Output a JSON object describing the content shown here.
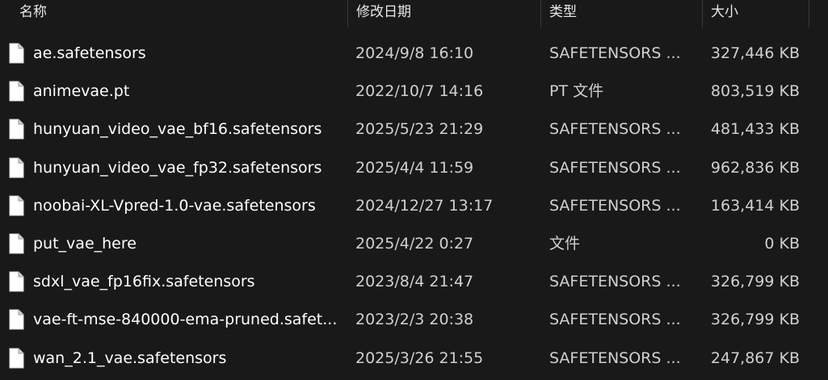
{
  "columns": {
    "name": "名称",
    "date": "修改日期",
    "type": "类型",
    "size": "大小"
  },
  "icon": "file-icon",
  "files": [
    {
      "name": "ae.safetensors",
      "date": "2024/9/8 16:10",
      "type": "SAFETENSORS ...",
      "size": "327,446 KB"
    },
    {
      "name": "animevae.pt",
      "date": "2022/10/7 14:16",
      "type": "PT 文件",
      "size": "803,519 KB"
    },
    {
      "name": "hunyuan_video_vae_bf16.safetensors",
      "date": "2025/5/23 21:29",
      "type": "SAFETENSORS ...",
      "size": "481,433 KB"
    },
    {
      "name": "hunyuan_video_vae_fp32.safetensors",
      "date": "2025/4/4 11:59",
      "type": "SAFETENSORS ...",
      "size": "962,836 KB"
    },
    {
      "name": "noobai-XL-Vpred-1.0-vae.safetensors",
      "date": "2024/12/27 13:17",
      "type": "SAFETENSORS ...",
      "size": "163,414 KB"
    },
    {
      "name": "put_vae_here",
      "date": "2025/4/22 0:27",
      "type": "文件",
      "size": "0 KB"
    },
    {
      "name": "sdxl_vae_fp16fix.safetensors",
      "date": "2023/8/4 21:47",
      "type": "SAFETENSORS ...",
      "size": "326,799 KB"
    },
    {
      "name": "vae-ft-mse-840000-ema-pruned.safet...",
      "date": "2023/2/3 20:38",
      "type": "SAFETENSORS ...",
      "size": "326,799 KB"
    },
    {
      "name": "wan_2.1_vae.safetensors",
      "date": "2025/3/26 21:55",
      "type": "SAFETENSORS ...",
      "size": "247,867 KB"
    }
  ]
}
